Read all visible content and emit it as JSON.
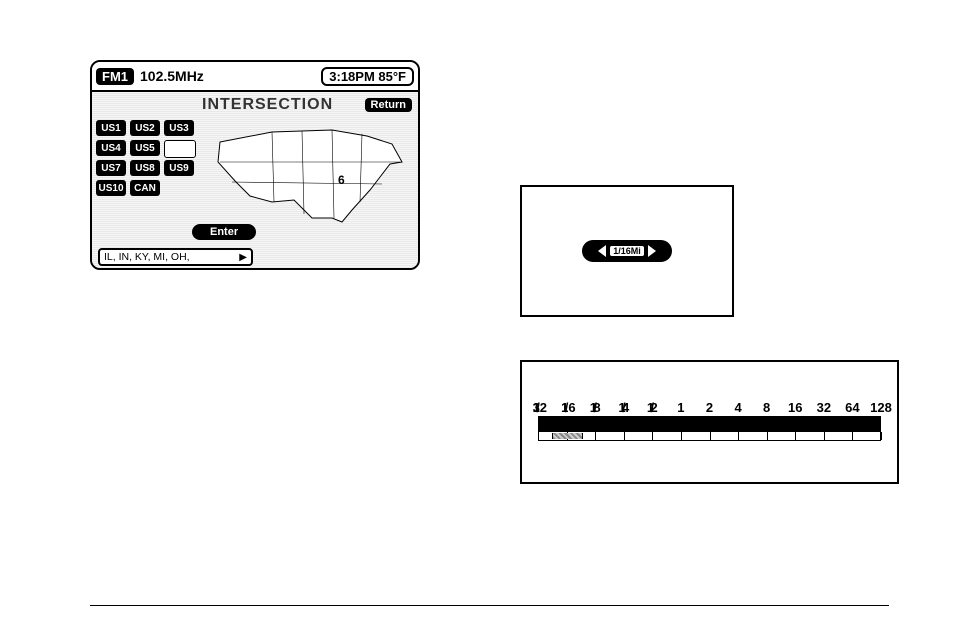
{
  "nav": {
    "band": "FM1",
    "frequency": "102.5MHz",
    "status": "3:18PM 85°F",
    "title": "INTERSECTION",
    "return_label": "Return",
    "enter_label": "Enter",
    "states_summary": "IL, IN, KY, MI, OH,",
    "regions": [
      "US1",
      "US2",
      "US3",
      "US4",
      "US5",
      "",
      "US7",
      "US8",
      "US9",
      "US10",
      "CAN"
    ],
    "map_region_label": "6"
  },
  "scale_pill": {
    "label": "1/16Mi"
  },
  "scale_bar": {
    "labels": [
      "1/32",
      "1/16",
      "1/8",
      "1/4",
      "1/2",
      "1",
      "2",
      "4",
      "8",
      "16",
      "32",
      "64",
      "128"
    ],
    "selected_index": 1
  }
}
